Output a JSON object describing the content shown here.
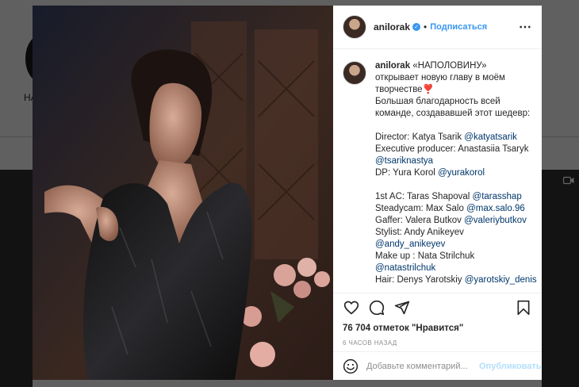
{
  "background": {
    "profile_name_fragment": "НА",
    "video_icon": "video-icon"
  },
  "post": {
    "username": "anilorak",
    "verified_icon": "verified-badge-icon",
    "dot": "•",
    "follow_label": "Подписаться",
    "more_icon": "ellipsis-icon",
    "caption_lines": [
      {
        "text": "«НАПОЛОВИНУ»",
        "kind": "first"
      },
      {
        "text": "открывает новую главу в моём"
      },
      {
        "text": "творчестве❣️"
      },
      {
        "text": "Большая благодарность всей"
      },
      {
        "text": "команде, создававшей этот шедевр:"
      },
      {
        "text": ""
      },
      {
        "pre": "Director: Katya Tsarik ",
        "mention": "@katyatsarik"
      },
      {
        "pre": "Executive producer: Anastasiia Tsaryk"
      },
      {
        "mention": "@tsariknastya"
      },
      {
        "pre": "DP: Yura Korol ",
        "mention": "@yurakorol"
      },
      {
        "text": ""
      },
      {
        "pre": "1st AC: Taras Shapoval ",
        "mention": "@tarasshap"
      },
      {
        "pre": "Steadycam: Max Salo ",
        "mention": "@max.salo.96"
      },
      {
        "pre": "Gaffer: Valera Butkov ",
        "mention": "@valeriybutkov"
      },
      {
        "pre": "Stylist: Andy Anikeyev"
      },
      {
        "mention": "@andy_anikeyev"
      },
      {
        "pre": "Make up : Nata Strilchuk"
      },
      {
        "mention": "@natastrilchuk"
      },
      {
        "pre": "Hair: Denys Yarotskiy ",
        "mention": "@yarotskiy_denis"
      }
    ],
    "likes": "76 704 отметок \"Нравится\"",
    "time": "6 ЧАСОВ НАЗАД",
    "comment_placeholder": "Добавьте комментарий...",
    "publish_label": "Опубликовать",
    "icons": [
      "heart-icon",
      "comment-icon",
      "share-icon",
      "bookmark-icon",
      "emoji-icon"
    ]
  },
  "colors": {
    "link": "#3897f0",
    "mention": "#00376b",
    "publish_disabled": "#b2dffc",
    "muted": "#8e8e8e"
  }
}
